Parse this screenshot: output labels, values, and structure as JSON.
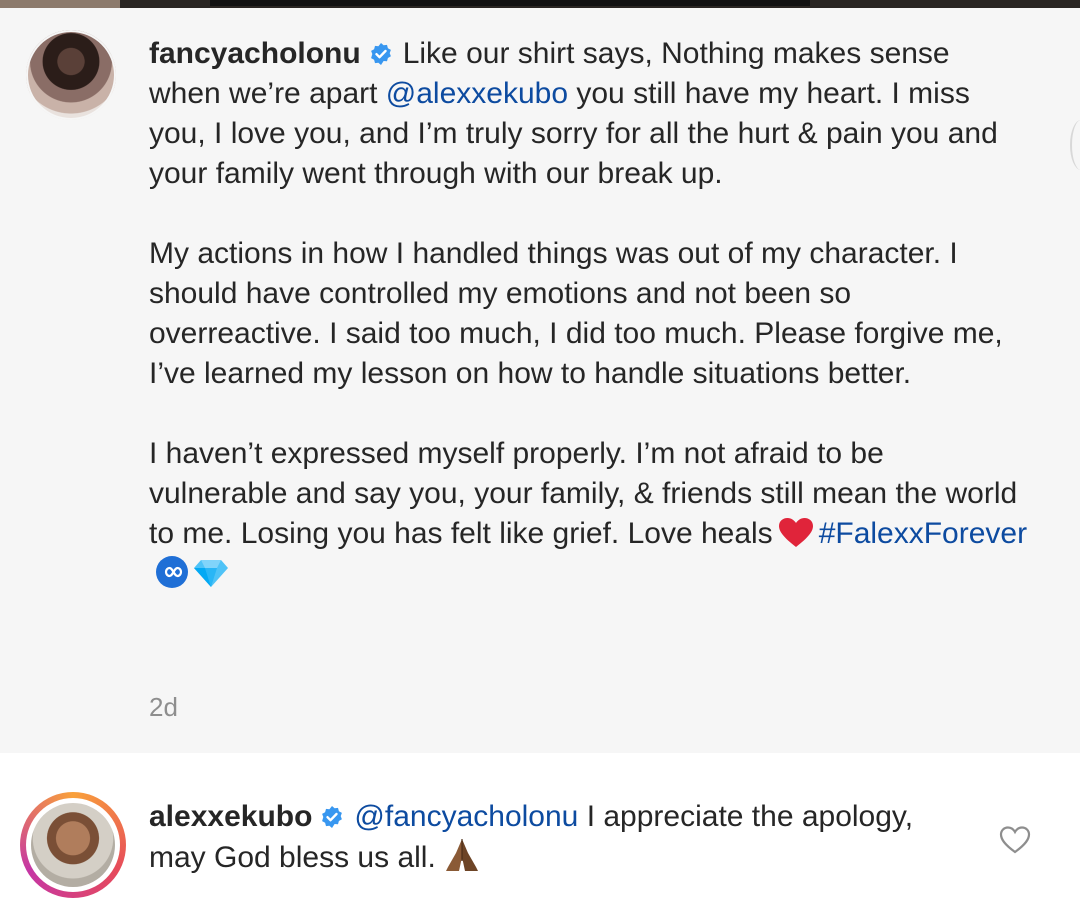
{
  "main_comment": {
    "username": "fancyacholonu",
    "paragraph_1_start": "Like our shirt says, Nothing makes sense when we’re apart ",
    "mention": "@alexxekubo",
    "paragraph_1_end": " you still have my heart. I miss you, I love you, and I’m truly sorry for all the hurt & pain you and your family went through with our break up.",
    "paragraph_2": "My actions in how I handled things was out of my character. I should have controlled my emotions and not been so overreactive. I said too much, I did too much. Please forgive me, I’ve learned my lesson on how to handle situations better.",
    "paragraph_3": "I haven’t expressed myself properly. I’m not afraid to be vulnerable and say you, your family, & friends still mean the world to me. Losing you has felt like grief. Love heals",
    "hashtag": "#FalexxForever",
    "timestamp": "2d"
  },
  "reply_comment": {
    "username": "alexxekubo",
    "mention": "@fancyacholonu",
    "text": " I appreciate the apology, may God bless us all."
  },
  "icons": {
    "verified": "verified-badge-icon",
    "heart_emoji": "red-heart-emoji-icon",
    "infinity_emoji": "infinity-emoji-icon",
    "gem_emoji": "gem-emoji-icon",
    "pray_emoji": "praying-hands-emoji-icon",
    "like": "heart-outline-icon"
  },
  "colors": {
    "link": "#0d4ba0",
    "verified": "#3897f0",
    "muted": "#8e8e8e",
    "heart": "#e0243a"
  }
}
